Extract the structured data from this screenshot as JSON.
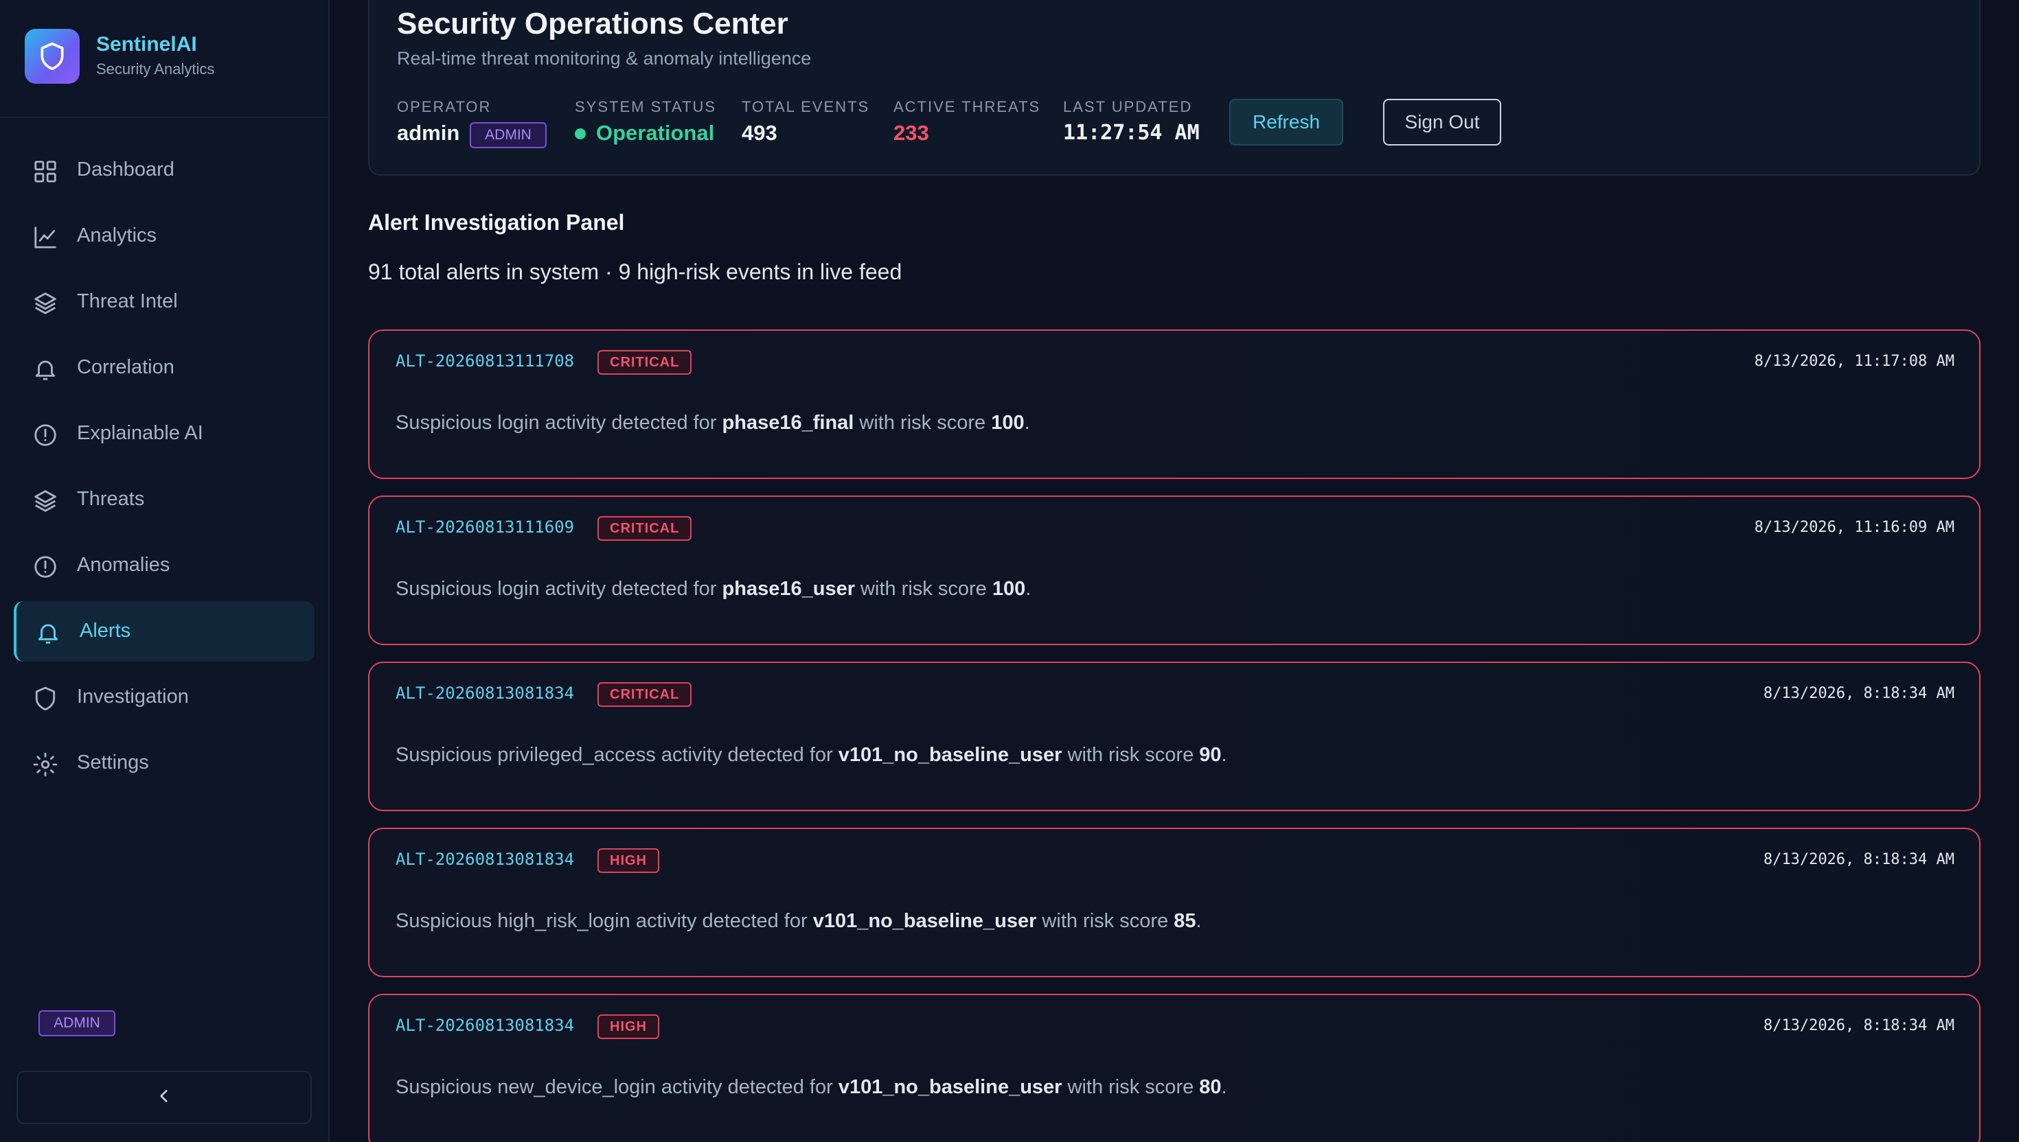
{
  "brand": {
    "name": "SentinelAI",
    "subtitle": "Security Analytics"
  },
  "sidebar": {
    "items": [
      {
        "label": "Dashboard",
        "icon": "grid-icon",
        "active": false
      },
      {
        "label": "Analytics",
        "icon": "line-chart-icon",
        "active": false
      },
      {
        "label": "Threat Intel",
        "icon": "layers-icon",
        "active": false
      },
      {
        "label": "Correlation",
        "icon": "bell-icon",
        "active": false
      },
      {
        "label": "Explainable AI",
        "icon": "alert-circle-icon",
        "active": false
      },
      {
        "label": "Threats",
        "icon": "layers-icon",
        "active": false
      },
      {
        "label": "Anomalies",
        "icon": "alert-circle-icon",
        "active": false
      },
      {
        "label": "Alerts",
        "icon": "bell-icon",
        "active": true
      },
      {
        "label": "Investigation",
        "icon": "shield-icon",
        "active": false
      },
      {
        "label": "Settings",
        "icon": "gear-icon",
        "active": false
      }
    ],
    "role_badge": "ADMIN",
    "collapse_icon": "chevron-left-icon"
  },
  "header": {
    "title": "Security Operations Center",
    "subtitle": "Real-time threat monitoring & anomaly intelligence",
    "operator": {
      "label": "OPERATOR",
      "value": "admin",
      "role": "ADMIN"
    },
    "system_status": {
      "label": "SYSTEM STATUS",
      "value": "Operational"
    },
    "total_events": {
      "label": "TOTAL EVENTS",
      "value": "493"
    },
    "active_threats": {
      "label": "ACTIVE THREATS",
      "value": "233"
    },
    "last_updated": {
      "label": "LAST UPDATED",
      "value": "11:27:54 AM"
    },
    "refresh_label": "Refresh",
    "signout_label": "Sign Out"
  },
  "panel": {
    "title": "Alert Investigation Panel",
    "summary": "91 total alerts in system · 9 high-risk events in live feed"
  },
  "alerts": [
    {
      "id": "ALT-20260813111708",
      "severity": "CRITICAL",
      "time": "8/13/2026, 11:17:08 AM",
      "prefix": "Suspicious login activity detected for ",
      "user": "phase16_final",
      "mid": " with risk score ",
      "score": "100",
      "suffix": "."
    },
    {
      "id": "ALT-20260813111609",
      "severity": "CRITICAL",
      "time": "8/13/2026, 11:16:09 AM",
      "prefix": "Suspicious login activity detected for ",
      "user": "phase16_user",
      "mid": " with risk score ",
      "score": "100",
      "suffix": "."
    },
    {
      "id": "ALT-20260813081834",
      "severity": "CRITICAL",
      "time": "8/13/2026, 8:18:34 AM",
      "prefix": "Suspicious privileged_access activity detected for ",
      "user": "v101_no_baseline_user",
      "mid": " with risk score ",
      "score": "90",
      "suffix": "."
    },
    {
      "id": "ALT-20260813081834",
      "severity": "HIGH",
      "time": "8/13/2026, 8:18:34 AM",
      "prefix": "Suspicious high_risk_login activity detected for ",
      "user": "v101_no_baseline_user",
      "mid": " with risk score ",
      "score": "85",
      "suffix": "."
    },
    {
      "id": "ALT-20260813081834",
      "severity": "HIGH",
      "time": "8/13/2026, 8:18:34 AM",
      "prefix": "Suspicious new_device_login activity detected for ",
      "user": "v101_no_baseline_user",
      "mid": " with risk score ",
      "score": "80",
      "suffix": "."
    }
  ],
  "colors": {
    "accent": "#5ed1ee",
    "critical": "#e0425a",
    "operational": "#34d399",
    "threats": "#f0536b",
    "admin": "#a98bf5"
  }
}
